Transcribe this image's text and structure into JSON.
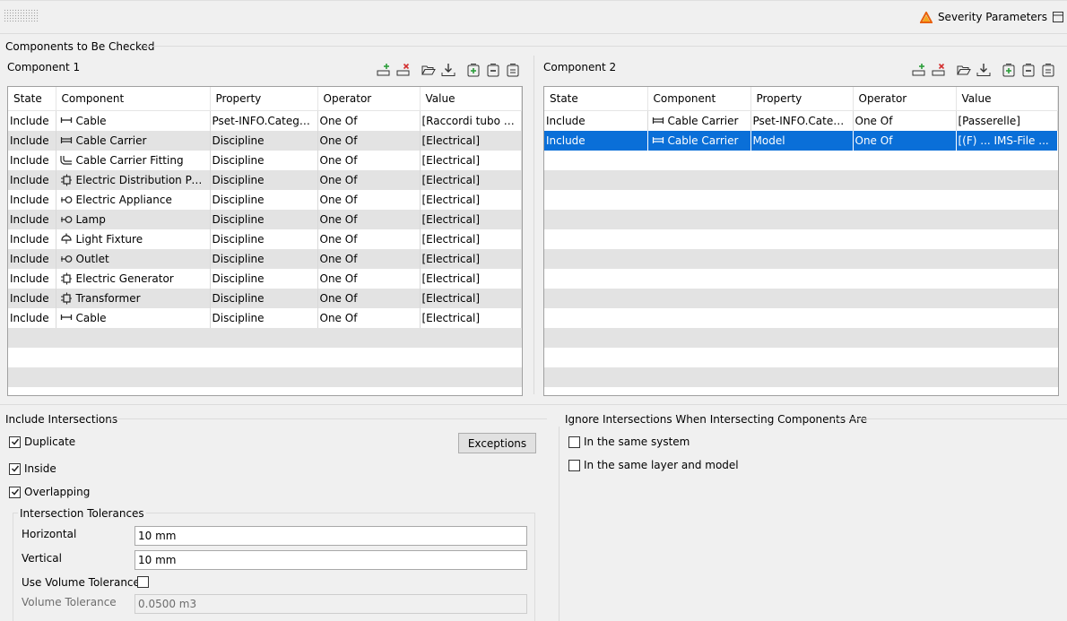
{
  "header": {
    "severity_label": "Severity Parameters"
  },
  "components_section": {
    "title": "Components to Be Checked"
  },
  "columns": [
    "State",
    "Component",
    "Property",
    "Operator",
    "Value"
  ],
  "component1": {
    "title": "Component 1",
    "rows": [
      {
        "state": "Include",
        "icon": "cable-icon",
        "component": "Cable",
        "property": "Pset-INFO.Categoria",
        "operator": "One Of",
        "value": "[Raccordi tubo pro..."
      },
      {
        "state": "Include",
        "icon": "cable-carrier-icon",
        "component": "Cable Carrier",
        "property": "Discipline",
        "operator": "One Of",
        "value": "[Electrical]"
      },
      {
        "state": "Include",
        "icon": "cable-carrier-fitting-icon",
        "component": "Cable Carrier Fitting",
        "property": "Discipline",
        "operator": "One Of",
        "value": "[Electrical]"
      },
      {
        "state": "Include",
        "icon": "electric-distribution-point-icon",
        "component": "Electric Distribution Point",
        "property": "Discipline",
        "operator": "One Of",
        "value": "[Electrical]"
      },
      {
        "state": "Include",
        "icon": "electric-appliance-icon",
        "component": "Electric Appliance",
        "property": "Discipline",
        "operator": "One Of",
        "value": "[Electrical]"
      },
      {
        "state": "Include",
        "icon": "lamp-icon",
        "component": "Lamp",
        "property": "Discipline",
        "operator": "One Of",
        "value": "[Electrical]"
      },
      {
        "state": "Include",
        "icon": "light-fixture-icon",
        "component": "Light Fixture",
        "property": "Discipline",
        "operator": "One Of",
        "value": "[Electrical]"
      },
      {
        "state": "Include",
        "icon": "outlet-icon",
        "component": "Outlet",
        "property": "Discipline",
        "operator": "One Of",
        "value": "[Electrical]"
      },
      {
        "state": "Include",
        "icon": "electric-generator-icon",
        "component": "Electric Generator",
        "property": "Discipline",
        "operator": "One Of",
        "value": "[Electrical]"
      },
      {
        "state": "Include",
        "icon": "transformer-icon",
        "component": "Transformer",
        "property": "Discipline",
        "operator": "One Of",
        "value": "[Electrical]"
      },
      {
        "state": "Include",
        "icon": "cable-icon",
        "component": "Cable",
        "property": "Discipline",
        "operator": "One Of",
        "value": "[Electrical]"
      }
    ]
  },
  "component2": {
    "title": "Component 2",
    "rows": [
      {
        "state": "Include",
        "icon": "cable-carrier-icon",
        "component": "Cable Carrier",
        "property": "Pset-INFO.Categoria",
        "operator": "One Of",
        "value": "[Passerelle]"
      },
      {
        "state": "Include",
        "icon": "cable-carrier-icon",
        "component": "Cable Carrier",
        "property": "Model",
        "operator": "One Of",
        "value": "[(F) ... IMS-File ..."
      }
    ]
  },
  "include_intersections": {
    "title": "Include Intersections",
    "duplicate": "Duplicate",
    "inside": "Inside",
    "overlapping": "Overlapping",
    "exceptions_button": "Exceptions",
    "tolerances_title": "Intersection Tolerances",
    "horizontal_label": "Horizontal",
    "horizontal_value": "10 mm",
    "vertical_label": "Vertical",
    "vertical_value": "10 mm",
    "use_volume_label": "Use Volume Tolerance",
    "volume_label": "Volume Tolerance",
    "volume_value": "0.0500 m3"
  },
  "ignore_intersections": {
    "title": "Ignore Intersections When Intersecting Components Are",
    "same_system": "In the same system",
    "same_layer_model": "In the same layer and model"
  },
  "colors": {
    "selection": "#0a6fd8",
    "alt_row": "#e3e3e3",
    "add": "#2a9d3a",
    "remove": "#d32f2f",
    "severity": "#e8600c"
  }
}
